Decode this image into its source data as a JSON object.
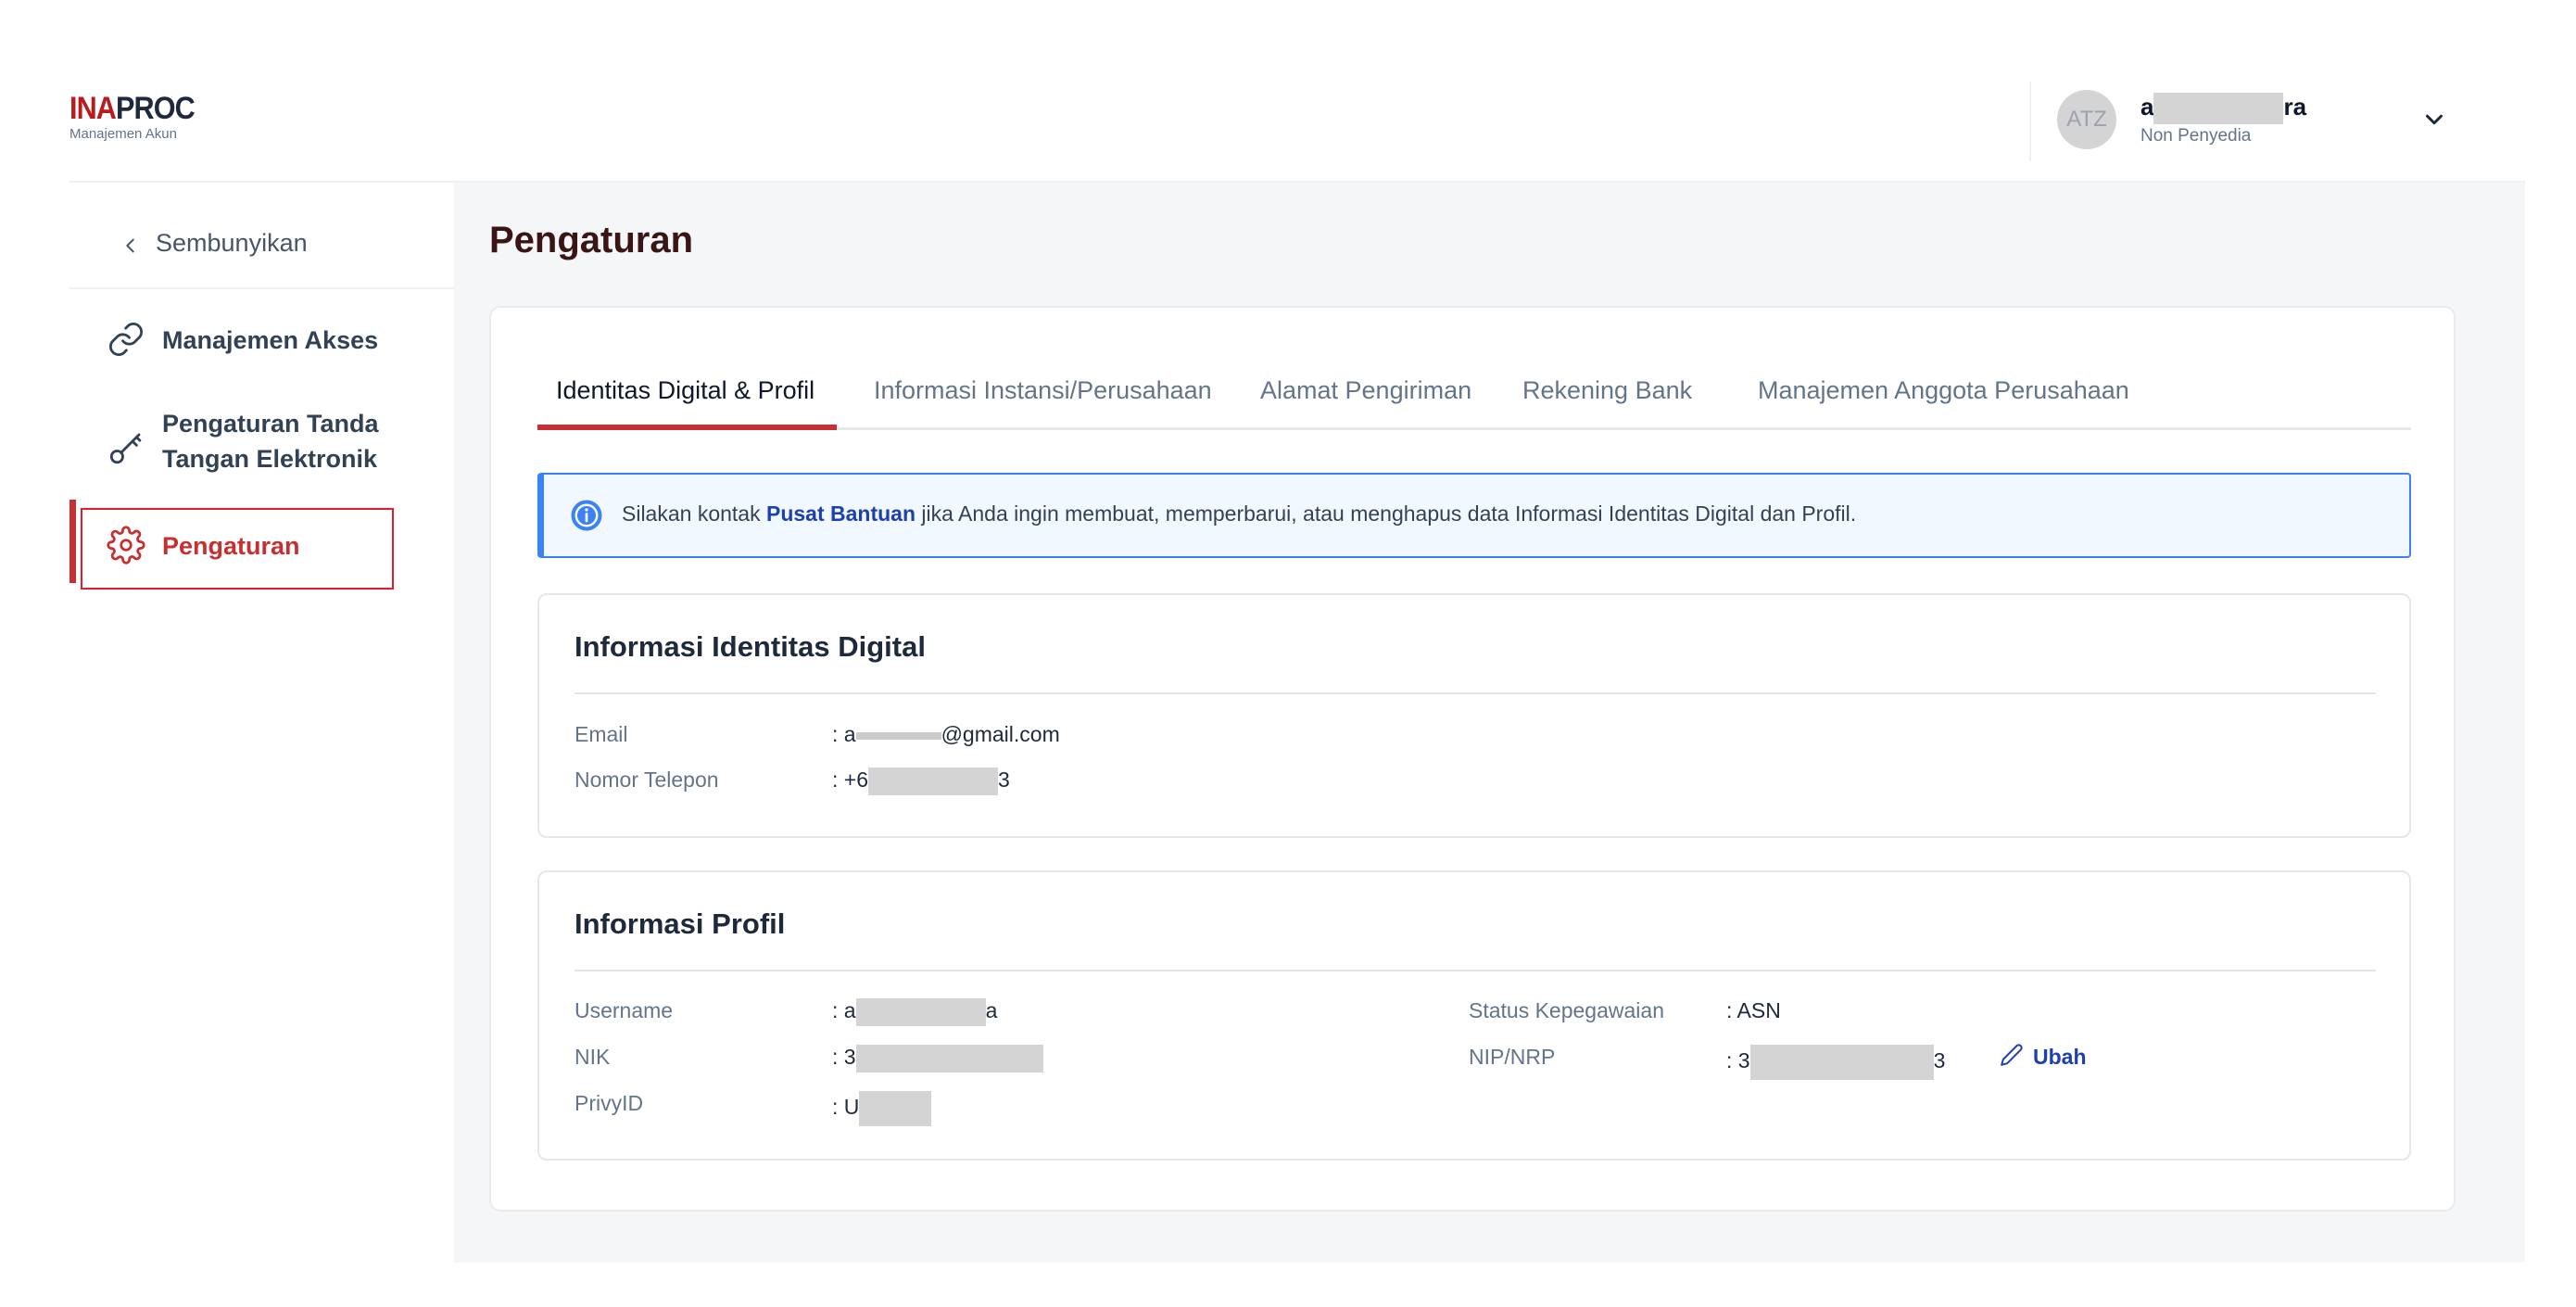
{
  "header": {
    "logo_part1": "INA",
    "logo_part2": "PROC",
    "logo_sub": "Manajemen Akun",
    "avatar_initials": "ATZ",
    "user_name_start": "a",
    "user_name_end": "ra",
    "user_role": "Non Penyedia"
  },
  "sidebar": {
    "hide_label": "Sembunyikan",
    "items": [
      {
        "label": "Manajemen Akses",
        "icon": "link-icon"
      },
      {
        "label_line1": "Pengaturan Tanda",
        "label_line2": "Tangan Elektronik",
        "icon": "key-icon"
      },
      {
        "label": "Pengaturan",
        "icon": "gear-icon",
        "active": true
      }
    ]
  },
  "main": {
    "page_title": "Pengaturan",
    "tabs": [
      {
        "label": "Identitas Digital & Profil",
        "active": true
      },
      {
        "label": "Informasi Instansi/Perusahaan"
      },
      {
        "label": "Alamat Pengiriman"
      },
      {
        "label": "Rekening Bank"
      },
      {
        "label": "Manajemen Anggota Perusahaan"
      }
    ],
    "alert": {
      "prefix": "Silakan kontak ",
      "link": "Pusat Bantuan",
      "suffix": " jika Anda ingin membuat, memperbarui, atau menghapus data Informasi Identitas Digital dan Profil."
    },
    "digital_identity": {
      "title": "Informasi Identitas Digital",
      "email_label": "Email",
      "email_prefix": ": a",
      "email_suffix": "@gmail.com",
      "phone_label": "Nomor Telepon",
      "phone_prefix": ": +6",
      "phone_suffix": "3"
    },
    "profile": {
      "title": "Informasi Profil",
      "username_label": "Username",
      "username_prefix": ": a",
      "username_suffix": "a",
      "nik_label": "NIK",
      "nik_prefix": ": 3",
      "privy_label": "PrivyID",
      "privy_prefix": ": U",
      "status_label": "Status Kepegawaian",
      "status_value": ": ASN",
      "nip_label": "NIP/NRP",
      "nip_prefix": ": 3",
      "nip_suffix": "3",
      "edit_label": "Ubah"
    }
  },
  "colors": {
    "accent_red": "#c53030",
    "link_blue": "#1e40af",
    "alert_border": "#3b82f6",
    "highlight_box": "#e11d2e"
  }
}
